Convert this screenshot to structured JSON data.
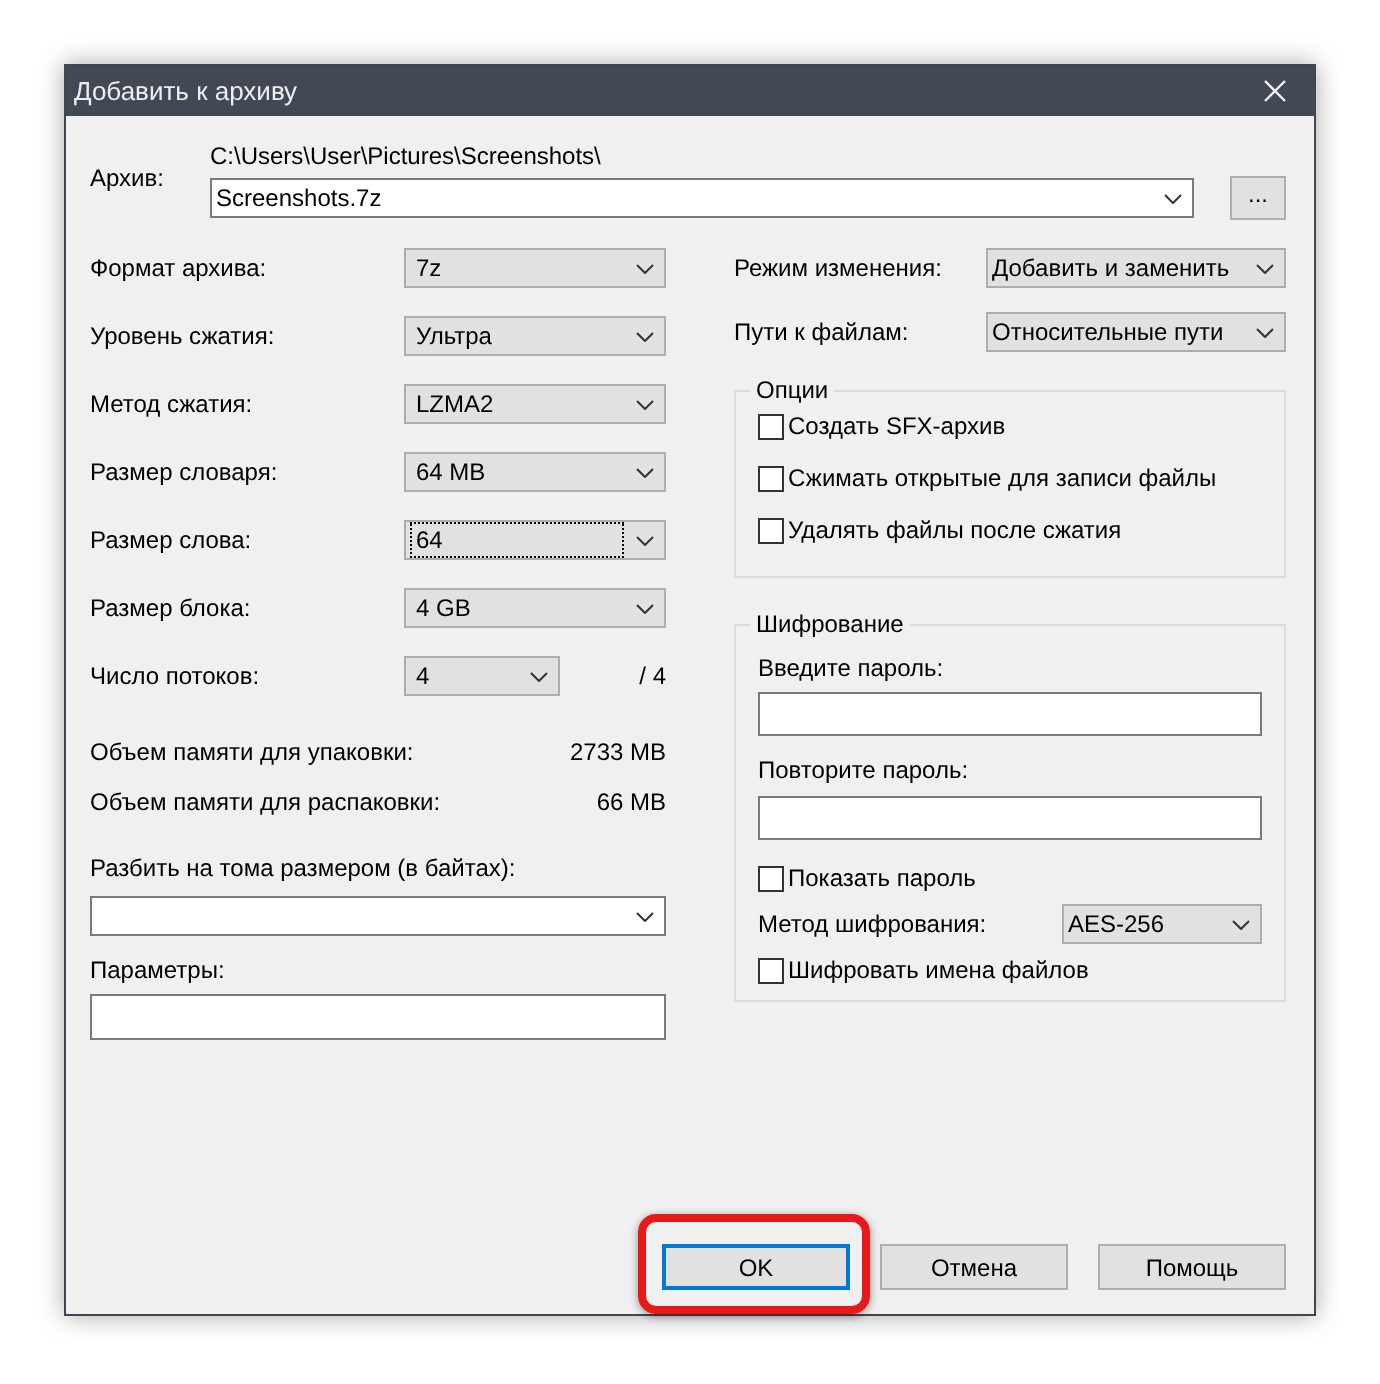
{
  "window": {
    "title": "Добавить к архиву"
  },
  "archive": {
    "label": "Архив:",
    "path": "C:\\Users\\User\\Pictures\\Screenshots\\",
    "value": "Screenshots.7z",
    "browse": "..."
  },
  "left_settings": [
    {
      "kind": "combo",
      "label": "Формат архива:",
      "value": "7z",
      "focused": false
    },
    {
      "kind": "combo",
      "label": "Уровень сжатия:",
      "value": "Ультра",
      "focused": false
    },
    {
      "kind": "combo",
      "label": "Метод сжатия:",
      "value": "LZMA2",
      "focused": false
    },
    {
      "kind": "combo",
      "label": "Размер словаря:",
      "value": "64 MB",
      "focused": false
    },
    {
      "kind": "combo",
      "label": "Размер слова:",
      "value": "64",
      "focused": true
    },
    {
      "kind": "combo",
      "label": "Размер блока:",
      "value": "4 GB",
      "focused": false
    },
    {
      "kind": "short",
      "label": "Число потоков:",
      "value": "4",
      "focused": false,
      "suffix": "/ 4"
    }
  ],
  "memory": [
    {
      "label": "Объем памяти для упаковки:",
      "value": "2733 MB"
    },
    {
      "label": "Объем памяти для распаковки:",
      "value": "66 MB"
    }
  ],
  "split": {
    "label": "Разбить на тома размером (в байтах):"
  },
  "params": {
    "label": "Параметры:"
  },
  "right_settings": [
    {
      "label": "Режим изменения:",
      "value": "Добавить и заменить"
    },
    {
      "label": "Пути к файлам:",
      "value": "Относительные пути"
    }
  ],
  "options": {
    "title": "Опции",
    "items": [
      {
        "label": "Создать SFX-архив",
        "checked": false
      },
      {
        "label": "Сжимать открытые для записи файлы",
        "checked": false
      },
      {
        "label": "Удалять файлы после сжатия",
        "checked": false
      }
    ]
  },
  "encryption": {
    "title": "Шифрование",
    "password_label": "Введите пароль:",
    "repeat_label": "Повторите пароль:",
    "show_password": {
      "label": "Показать пароль",
      "checked": false
    },
    "method": {
      "label": "Метод шифрования:",
      "value": "AES-256"
    },
    "encrypt_names": {
      "label": "Шифровать имена файлов",
      "checked": false
    }
  },
  "buttons": [
    {
      "label": "OK",
      "default": true,
      "highlighted": true
    },
    {
      "label": "Отмена",
      "default": false,
      "highlighted": false
    },
    {
      "label": "Помощь",
      "default": false,
      "highlighted": false
    }
  ]
}
